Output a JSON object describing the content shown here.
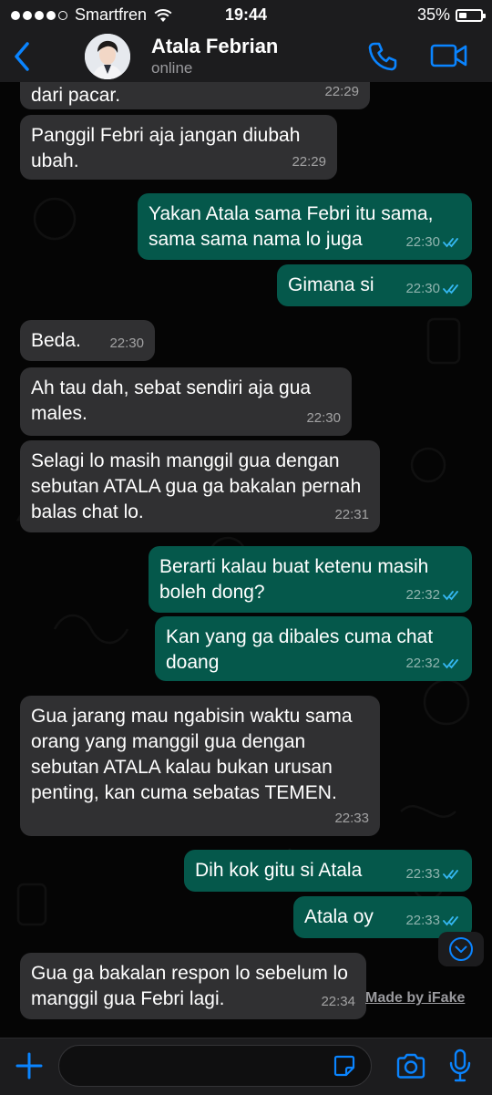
{
  "status_bar": {
    "carrier": "Smartfren",
    "time": "19:44",
    "battery": "35%",
    "battery_level": 0.35,
    "signal_bars": 4
  },
  "header": {
    "contact_name": "Atala Febrian",
    "contact_status": "online",
    "icons": [
      "back-chevron-icon",
      "avatar",
      "phone-icon",
      "video-camera-icon"
    ],
    "accent_color": "#0a84ff"
  },
  "messages": [
    {
      "direction": "in",
      "text": "dari pacar.",
      "time": "22:29"
    },
    {
      "direction": "in",
      "text": "Panggil Febri aja jangan diubah ubah.",
      "time": "22:29"
    },
    {
      "direction": "out",
      "text": "Yakan Atala sama Febri itu sama, sama sama nama lo juga",
      "time": "22:30"
    },
    {
      "direction": "out",
      "text": "Gimana si",
      "time": "22:30"
    },
    {
      "direction": "in",
      "text": "Beda.",
      "time": "22:30"
    },
    {
      "direction": "in",
      "text": "Ah tau dah, sebat sendiri aja gua males.",
      "time": "22:30"
    },
    {
      "direction": "in",
      "text": "Selagi lo masih manggil gua dengan sebutan ATALA gua ga bakalan pernah balas chat lo.",
      "time": "22:31"
    },
    {
      "direction": "out",
      "text": "Berarti kalau buat ketenu masih boleh dong?",
      "time": "22:32"
    },
    {
      "direction": "out",
      "text": "Kan yang ga dibales cuma chat doang",
      "time": "22:32"
    },
    {
      "direction": "in",
      "text": "Gua jarang mau ngabisin waktu sama orang yang manggil gua dengan sebutan ATALA kalau bukan urusan penting, kan cuma sebatas TEMEN.",
      "time": "22:33"
    },
    {
      "direction": "out",
      "text": "Dih kok gitu si Atala",
      "time": "22:33"
    },
    {
      "direction": "out",
      "text": "Atala oy",
      "time": "22:33"
    },
    {
      "direction": "in",
      "text": "Gua ga bakalan respon lo sebelum lo manggil gua Febri lagi.",
      "time": "22:34"
    }
  ],
  "watermark": "Made by iFake",
  "composer": {
    "placeholder": "",
    "icons": [
      "plus-icon",
      "sticker-icon",
      "camera-icon",
      "microphone-icon"
    ]
  },
  "colors": {
    "incoming_bubble": "#303032",
    "outgoing_bubble": "#05584b",
    "read_ticks": "#34b7f1",
    "bar_background": "#1c1c1e"
  }
}
